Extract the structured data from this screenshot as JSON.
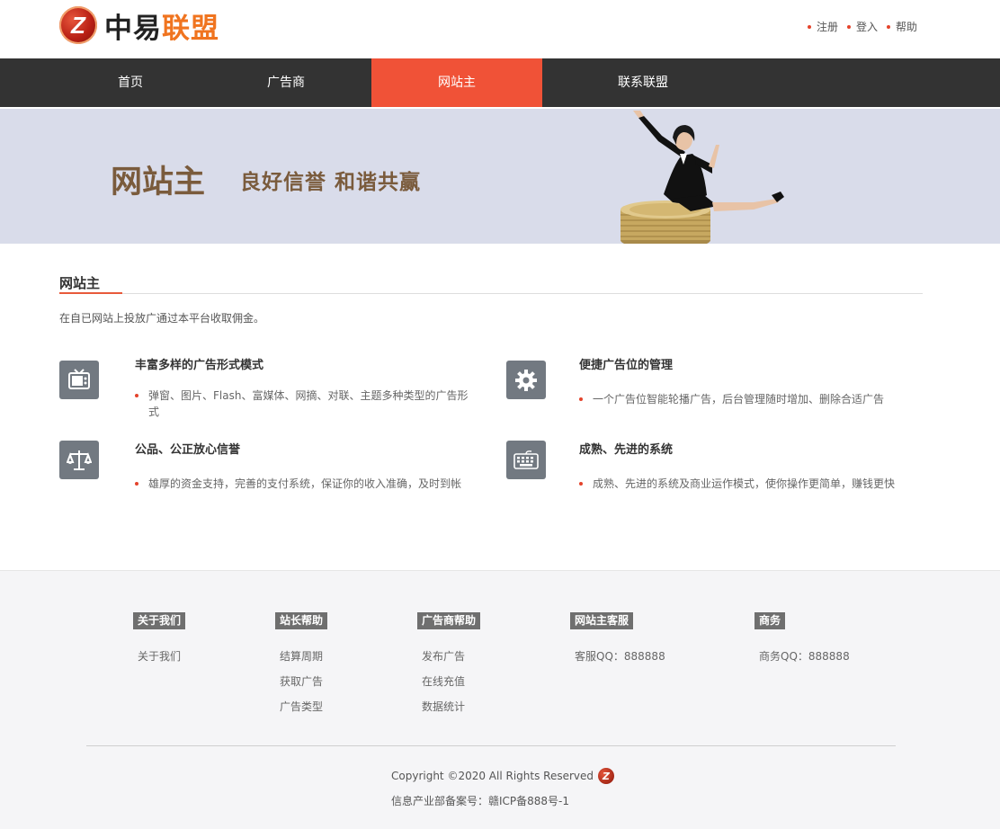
{
  "brand": {
    "logo_letter": "Z",
    "name_part1": "中易",
    "name_part2": "联盟",
    "accent_color": "#f0741f"
  },
  "top_links": [
    {
      "label": "注册"
    },
    {
      "label": "登入"
    },
    {
      "label": "帮助"
    }
  ],
  "nav": {
    "items": [
      {
        "label": "首页"
      },
      {
        "label": "广告商"
      },
      {
        "label": "网站主",
        "active": true
      },
      {
        "label": "联系联盟"
      }
    ],
    "active_color": "#f05237"
  },
  "banner": {
    "title": "网站主",
    "slogan": "良好信誉  和谐共赢"
  },
  "section": {
    "heading": "网站主",
    "description": "在自已网站上投放广通过本平台收取佣金。"
  },
  "features": [
    {
      "icon": "tv-icon",
      "title": "丰富多样的广告形式模式",
      "text": "弹窗、图片、Flash、富媒体、网摘、对联、主题多种类型的广告形式"
    },
    {
      "icon": "gear-icon",
      "title": "便捷广告位的管理",
      "text": "一个广告位智能轮播广告，后台管理随时增加、删除合适广告"
    },
    {
      "icon": "scale-icon",
      "title": "公品、公正放心信誉",
      "text": "雄厚的资金支持，完善的支付系统，保证你的收入准确，及时到帐"
    },
    {
      "icon": "keyboard-icon",
      "title": "成熟、先进的系统",
      "text": "成熟、先进的系统及商业运作模式，使你操作更简单，赚钱更快"
    }
  ],
  "footer": {
    "columns": [
      {
        "title": "关于我们",
        "links": [
          "关于我们"
        ]
      },
      {
        "title": "站长帮助",
        "links": [
          "结算周期",
          "获取广告",
          "广告类型"
        ]
      },
      {
        "title": "广告商帮助",
        "links": [
          "发布广告",
          "在线充值",
          "数据统计"
        ]
      },
      {
        "title": "网站主客服",
        "links": [
          "客服QQ：888888"
        ]
      },
      {
        "title": "商务",
        "links": [
          "商务QQ：888888"
        ]
      }
    ],
    "copyright": "Copyright ©2020 All Rights Reserved",
    "icp": "信息产业部备案号：赣ICP备888号-1"
  }
}
